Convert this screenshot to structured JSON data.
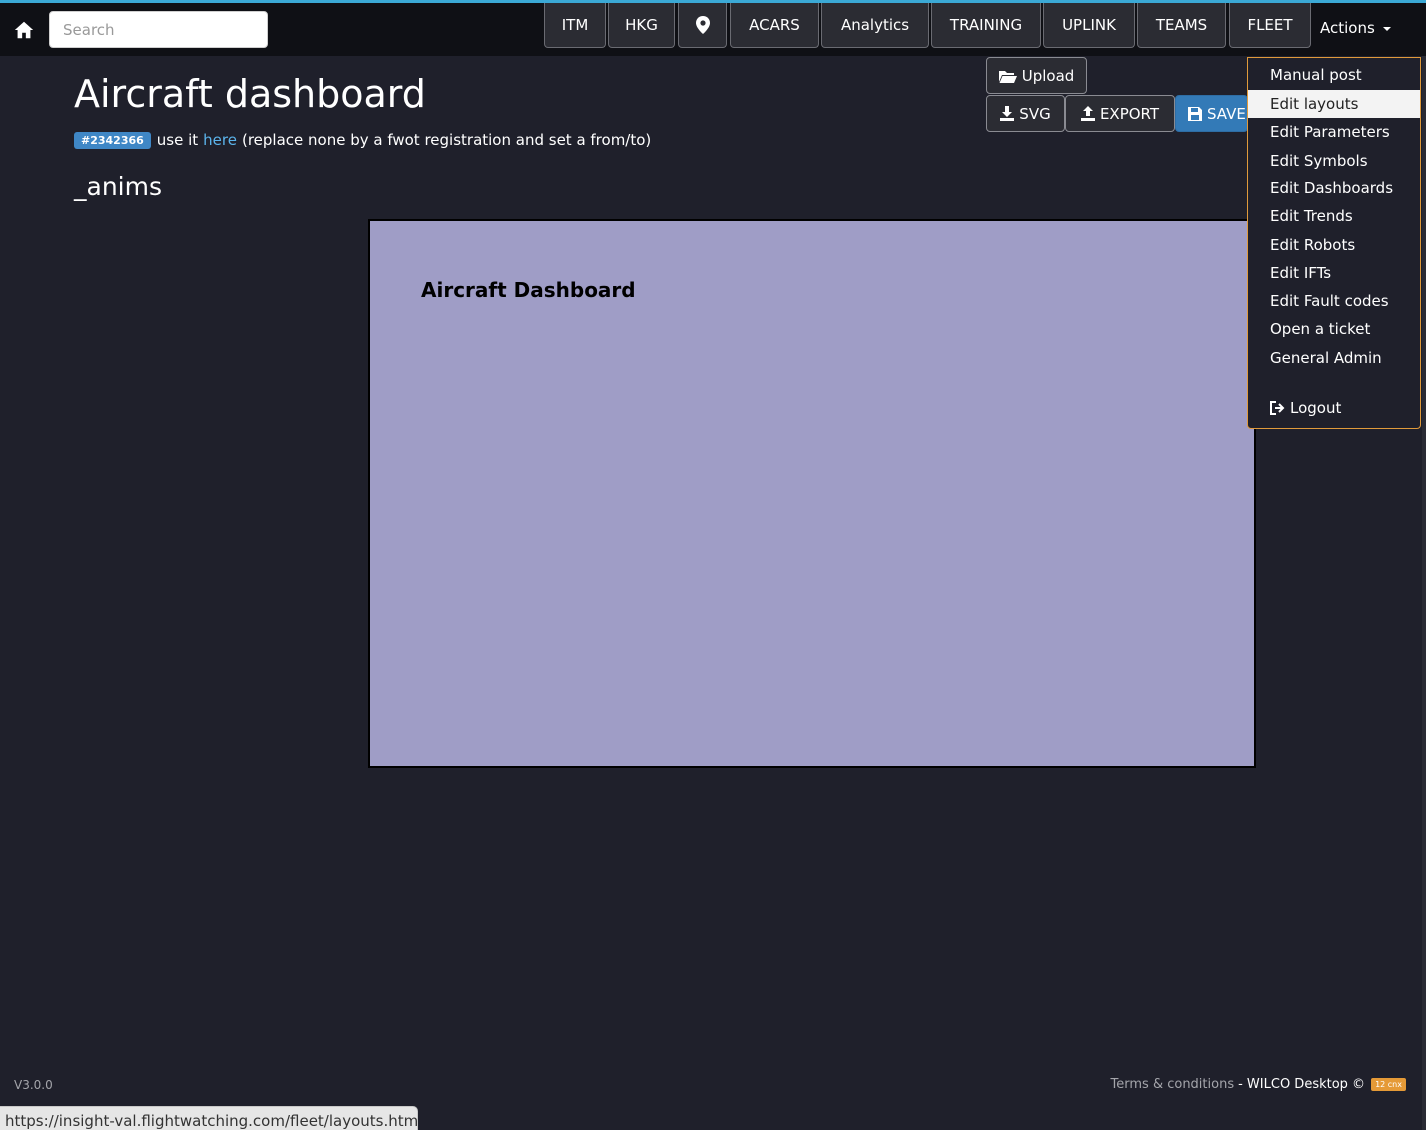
{
  "navbar": {
    "search_placeholder": "Search",
    "buttons": [
      "ITM",
      "HKG",
      "ACARS",
      "Analytics",
      "TRAINING",
      "UPLINK",
      "TEAMS",
      "FLEET"
    ],
    "actions_label": "Actions"
  },
  "page": {
    "title": "Aircraft dashboard",
    "badge": "#2342366",
    "info_prefix": "use it",
    "info_link": "here",
    "info_suffix": "(replace none by a fwot registration and set a from/to)",
    "subheading": "_anims"
  },
  "toolbar": {
    "upload_label": "Upload",
    "svg_label": "SVG",
    "export_label": "EXPORT",
    "save_label": "SAVE"
  },
  "canvas": {
    "title": "Aircraft Dashboard"
  },
  "actions_menu": {
    "items": [
      "Manual post",
      "Edit layouts",
      "Edit Parameters",
      "Edit Symbols",
      "Edit Dashboards",
      "Edit Trends",
      "Edit Robots",
      "Edit IFTs",
      "Edit Fault codes",
      "Open a ticket",
      "General Admin"
    ],
    "active_item": "Edit layouts",
    "logout_label": "Logout"
  },
  "footer": {
    "version": "V3.0.0",
    "terms": "Terms & conditions",
    "brand": "- WILCO Desktop ©",
    "cnx_badge": "12 cnx"
  },
  "status_url": "https://insight-val.flightwatching.com/fleet/layouts.html",
  "colors": {
    "background": "#1f202b",
    "navbar": "#0f1015",
    "canvas": "#9f9dc6",
    "accent_link": "#5bb4ec",
    "badge": "#3f87c6",
    "menu_border": "#e09a3b"
  },
  "icons": [
    "home-icon",
    "map-marker-icon",
    "folder-open-icon",
    "download-icon",
    "export-icon",
    "save-icon",
    "logout-icon",
    "caret-down-icon"
  ]
}
